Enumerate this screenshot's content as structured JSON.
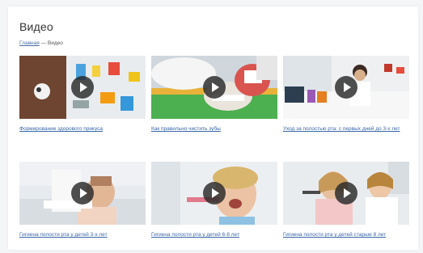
{
  "page": {
    "title": "Видео",
    "breadcrumb": {
      "home": "Главная",
      "separator": "—",
      "current": "Видео"
    }
  },
  "videos": [
    {
      "title": "Формирование здорового прикуса"
    },
    {
      "title": "Как правильно чистить зубы"
    },
    {
      "title": "Уход за полостью рта: с первых дней до 3-х лет"
    },
    {
      "title": "Гигиена полости рта у детей 3-х лет"
    },
    {
      "title": "Гигиена полости рта у детей 6-8 лет"
    },
    {
      "title": "Гигиена полости рта у детей старше 8 лет"
    }
  ],
  "colors": {
    "link": "#3a66a8",
    "play_button": "#282828"
  }
}
